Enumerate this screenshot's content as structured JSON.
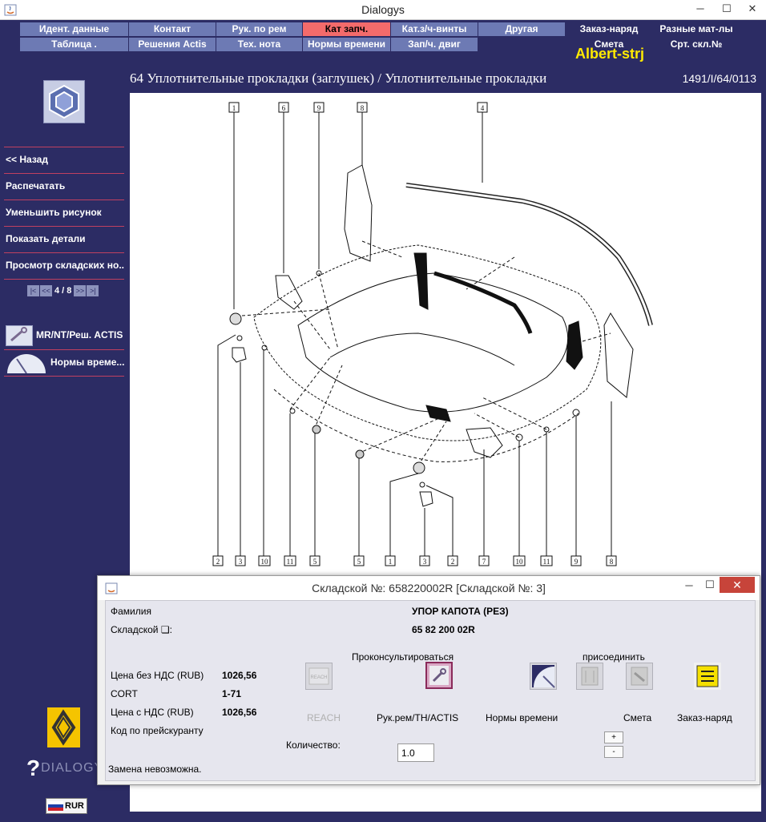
{
  "window": {
    "title": "Dialogys",
    "minimize_glyph": "─",
    "maximize_glyph": "☐",
    "close_glyph": "✕"
  },
  "topnav": {
    "row1": [
      "Идент. данные",
      "Контакт",
      "Рук. по рем",
      "Кат запч.",
      "Кат.з/ч-винты",
      "Другая",
      "Заказ-наряд",
      "Разные мат-лы"
    ],
    "row2": [
      "Таблица .",
      "Решения Actis",
      "Тех. нота",
      "Нормы времени",
      "Зап/ч. двиг",
      "",
      "Смета",
      "Срт. скл.№"
    ],
    "active_tab": "Кат запч.",
    "user": "Albert-strj"
  },
  "sidebar": {
    "menu": [
      "<< Назад",
      "Распечатать",
      "Уменьшить рисунок",
      "Показать детали",
      "Просмотр складских но..."
    ],
    "pager": {
      "first": "|<",
      "prev": "<<",
      "text": "4 / 8",
      "next": ">>",
      "last": ">|"
    },
    "shortcuts": [
      {
        "label": "MR/NT/Реш. ACTIS",
        "icon": "wrench-book-icon"
      },
      {
        "label": "Нормы време...",
        "icon": "clock-icon"
      }
    ],
    "brand": {
      "question": "?",
      "name": "DIALOGYS"
    },
    "currency": "RUR"
  },
  "content": {
    "title": "64 Уплотнительные прокладки (заглушек) / Уплотнительные прокладки",
    "code": "1491/I/64/0113"
  },
  "diagram": {
    "top_callouts": [
      "1",
      "6",
      "9",
      "8",
      "4"
    ],
    "bottom_callouts": [
      "2",
      "3",
      "10",
      "11",
      "5",
      "5",
      "1",
      "3",
      "2",
      "7",
      "10",
      "11",
      "9",
      "8"
    ]
  },
  "dialog": {
    "title": "Складской №: 658220002R [Складской №: 3]",
    "min_glyph": "─",
    "max_glyph": "☐",
    "close_glyph": "✕",
    "family_label": "Фамилия",
    "stock_label": "Складской ❏:",
    "part_name": "УПОР КАПОТА (РЕЗ)",
    "part_number": "65 82 200 02R",
    "consult_header": "Проконсультироваться",
    "attach_header": "присоединить",
    "price_excl_label": "Цена без НДС (RUB)",
    "price_excl_value": "1026,56",
    "cort_label": "CORT",
    "cort_value": "1-71",
    "price_incl_label": "Цена с НДС (RUB)",
    "price_incl_value": "1026,56",
    "pricelist_label": "Код по прейскуранту",
    "reach_label": "REACH",
    "reach_icon_text": "REACH",
    "actis_label": "Рук.рем/TH/ACTIS",
    "norms_label": "Нормы времени",
    "estimate_label": "Смета",
    "order_label": "Заказ-наряд",
    "quantity_label": "Количество:",
    "quantity_value": "1.0",
    "plus": "+",
    "minus": "-",
    "status": "Замена невозможна."
  },
  "colors": {
    "background": "#2c2c64",
    "tab": "#6d7ab4",
    "tab_active": "#f36b6b",
    "user": "#ffea00",
    "separator": "#c04060"
  }
}
